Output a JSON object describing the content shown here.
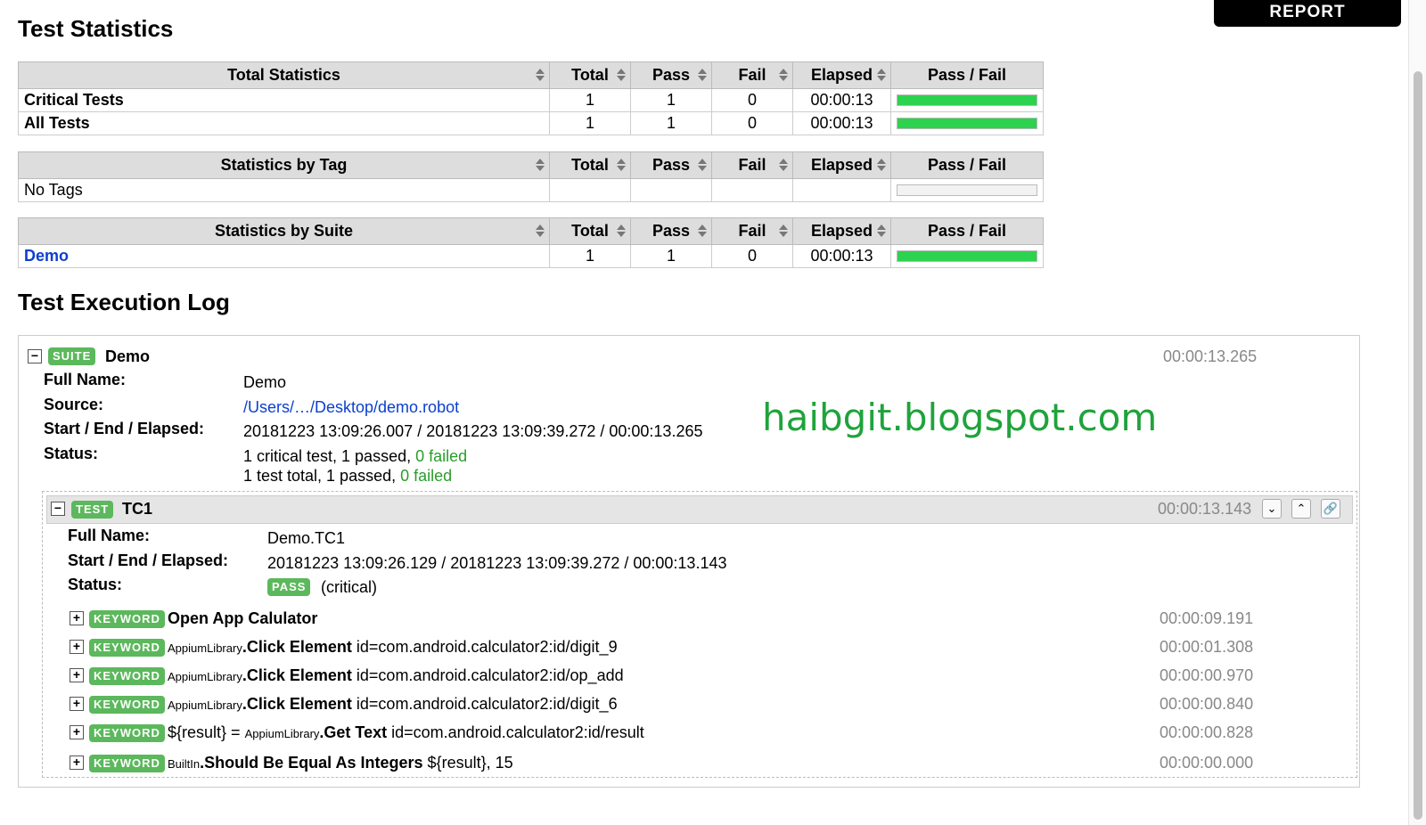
{
  "report_tab": "REPORT",
  "test_statistics": {
    "title": "Test Statistics",
    "columns": [
      "Total",
      "Pass",
      "Fail",
      "Elapsed",
      "Pass / Fail"
    ],
    "total": {
      "header": "Total Statistics",
      "rows": [
        {
          "name": "Critical Tests",
          "total": "1",
          "pass": "1",
          "fail": "0",
          "elapsed": "00:00:13",
          "pass_ratio": 1
        },
        {
          "name": "All Tests",
          "total": "1",
          "pass": "1",
          "fail": "0",
          "elapsed": "00:00:13",
          "pass_ratio": 1
        }
      ]
    },
    "by_tag": {
      "header": "Statistics by Tag",
      "rows": [
        {
          "name": "No Tags",
          "total": "",
          "pass": "",
          "fail": "",
          "elapsed": "",
          "pass_ratio": 0
        }
      ]
    },
    "by_suite": {
      "header": "Statistics by Suite",
      "rows": [
        {
          "name": "Demo",
          "total": "1",
          "pass": "1",
          "fail": "0",
          "elapsed": "00:00:13",
          "pass_ratio": 1
        }
      ]
    }
  },
  "log": {
    "title": "Test Execution Log",
    "suite": {
      "label": "SUITE",
      "name": "Demo",
      "elapsed": "00:00:13.265",
      "full_name_key": "Full Name:",
      "full_name": "Demo",
      "source_key": "Source:",
      "source": "/Users/…/Desktop/demo.robot",
      "times_key": "Start / End / Elapsed:",
      "times": "20181223 13:09:26.007 / 20181223 13:09:39.272 / 00:00:13.265",
      "status_key": "Status:",
      "status_line1_prefix": "1 critical test, 1 passed, ",
      "status_line1_failed": "0 failed",
      "status_line2_prefix": "1 test total, 1 passed, ",
      "status_line2_failed": "0 failed"
    },
    "test": {
      "label": "TEST",
      "name": "TC1",
      "elapsed": "00:00:13.143",
      "full_name_key": "Full Name:",
      "full_name": "Demo.TC1",
      "times_key": "Start / End / Elapsed:",
      "times": "20181223 13:09:26.129 / 20181223 13:09:39.272 / 00:00:13.143",
      "status_key": "Status:",
      "status_badge": "PASS",
      "status_note": "(critical)",
      "keywords": [
        {
          "label": "KEYWORD",
          "assign": "",
          "lib": "",
          "name": "Open App Calulator",
          "args": "",
          "elapsed": "00:00:09.191"
        },
        {
          "label": "KEYWORD",
          "assign": "",
          "lib": "AppiumLibrary",
          "name": "Click Element",
          "args": "id=com.android.calculator2:id/digit_9",
          "elapsed": "00:00:01.308"
        },
        {
          "label": "KEYWORD",
          "assign": "",
          "lib": "AppiumLibrary",
          "name": "Click Element",
          "args": "id=com.android.calculator2:id/op_add",
          "elapsed": "00:00:00.970"
        },
        {
          "label": "KEYWORD",
          "assign": "",
          "lib": "AppiumLibrary",
          "name": "Click Element",
          "args": "id=com.android.calculator2:id/digit_6",
          "elapsed": "00:00:00.840"
        },
        {
          "label": "KEYWORD",
          "assign": "${result} = ",
          "lib": "AppiumLibrary",
          "name": "Get Text",
          "args": "id=com.android.calculator2:id/result",
          "elapsed": "00:00:00.828"
        },
        {
          "label": "KEYWORD",
          "assign": "",
          "lib": "BuiltIn",
          "name": "Should Be Equal As Integers",
          "args": "${result}, 15",
          "elapsed": "00:00:00.000"
        }
      ]
    }
  },
  "watermark": "haibgit.blogspot.com",
  "colors": {
    "pass": "#2dd24f",
    "label": "#5cb85c",
    "link": "#0b3fcf"
  }
}
